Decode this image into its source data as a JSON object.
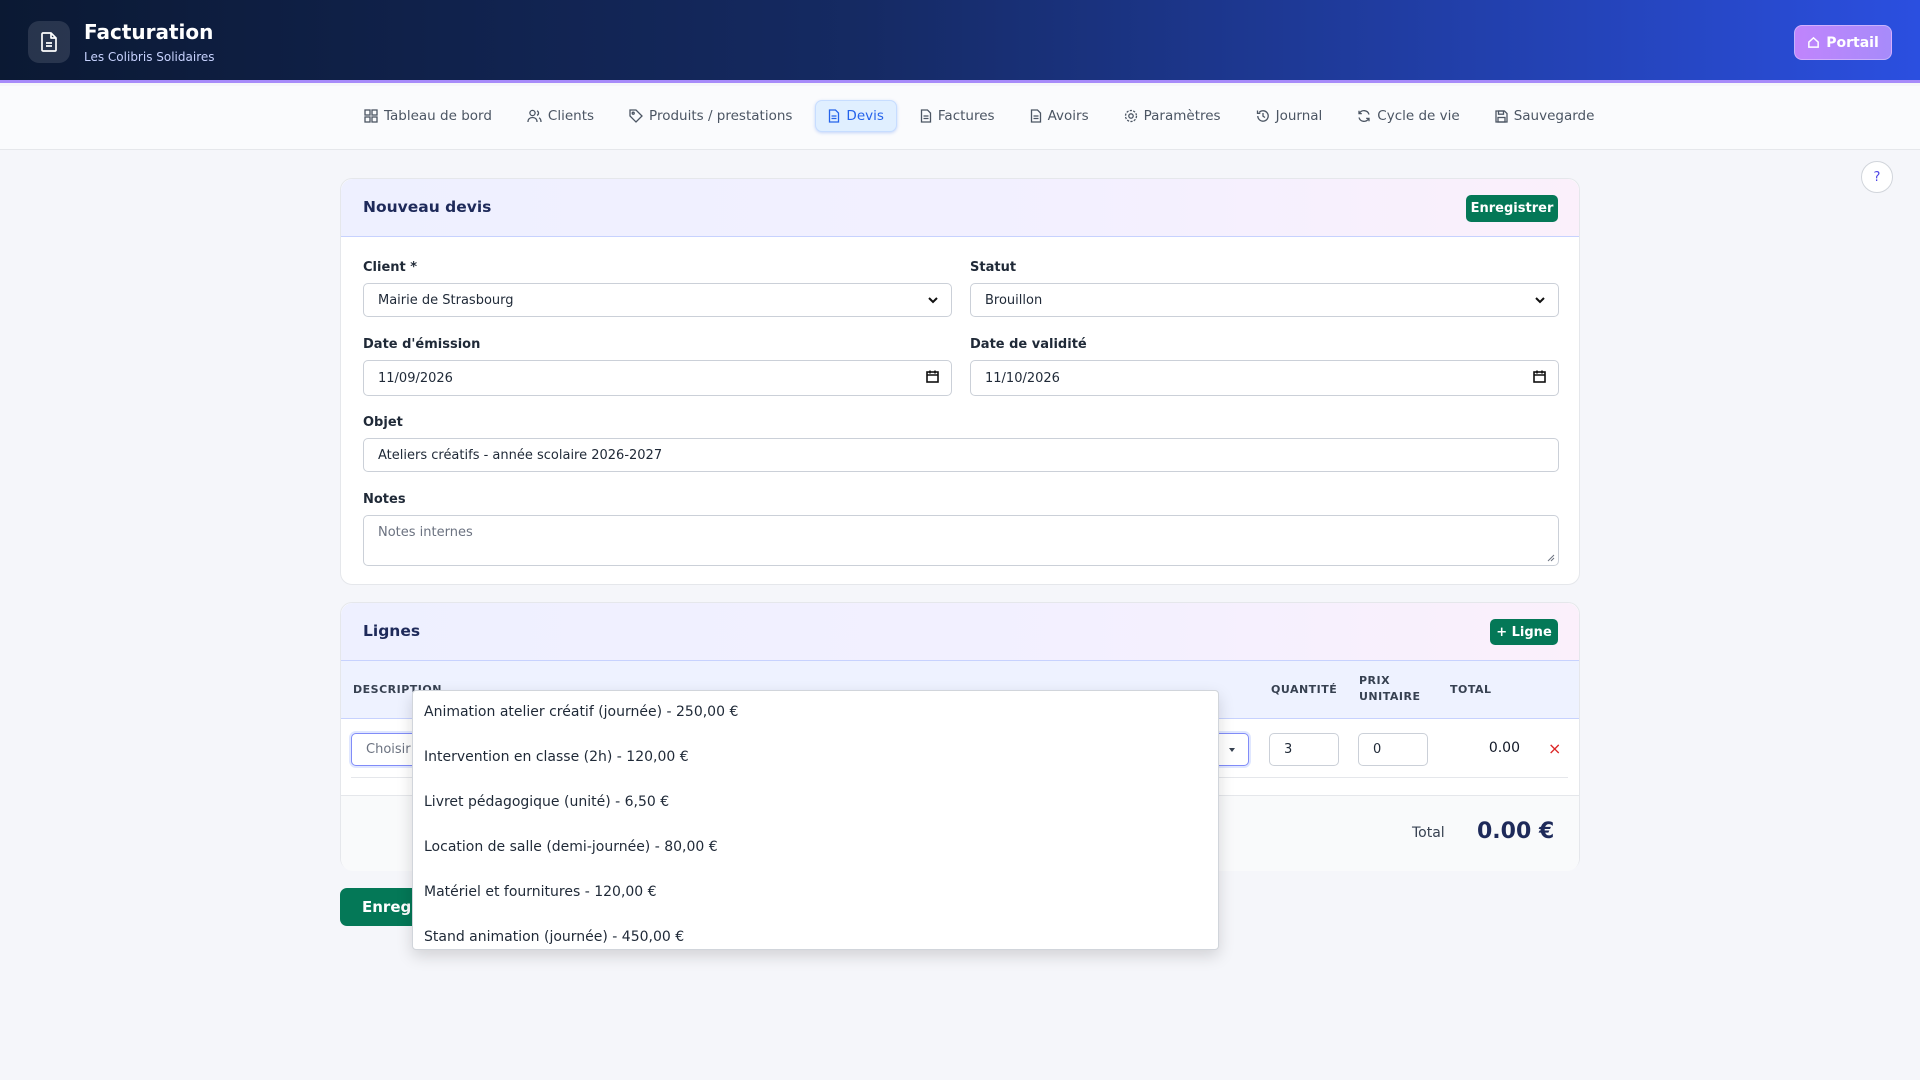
{
  "header": {
    "title": "Facturation",
    "subtitle": "Les Colibris Solidaires",
    "portal_label": "Portail"
  },
  "nav": {
    "items": [
      {
        "label": "Tableau de bord",
        "icon": "dashboard-icon"
      },
      {
        "label": "Clients",
        "icon": "users-icon"
      },
      {
        "label": "Produits / prestations",
        "icon": "tag-icon"
      },
      {
        "label": "Devis",
        "icon": "document-icon",
        "active": true
      },
      {
        "label": "Factures",
        "icon": "document-icon"
      },
      {
        "label": "Avoirs",
        "icon": "document-icon"
      },
      {
        "label": "Paramètres",
        "icon": "gear-icon"
      },
      {
        "label": "Journal",
        "icon": "history-icon"
      },
      {
        "label": "Cycle de vie",
        "icon": "refresh-icon"
      },
      {
        "label": "Sauvegarde",
        "icon": "save-icon"
      }
    ]
  },
  "help_label": "?",
  "quote_form": {
    "title": "Nouveau devis",
    "save_label": "Enregistrer",
    "client_label": "Client *",
    "client_value": "Mairie de Strasbourg",
    "status_label": "Statut",
    "status_value": "Brouillon",
    "issue_date_label": "Date d'émission",
    "issue_date_value": "11/09/2026",
    "validity_date_label": "Date de validité",
    "validity_date_value": "11/10/2026",
    "subject_label": "Objet",
    "subject_value": "Ateliers créatifs - année scolaire 2026-2027",
    "notes_label": "Notes",
    "notes_placeholder": "Notes internes"
  },
  "lines": {
    "title": "Lignes",
    "add_label": "+ Ligne",
    "columns": {
      "description": "DESCRIPTION",
      "quantity": "QUANTITÉ",
      "unit_price_1": "PRIX",
      "unit_price_2": "UNITAIRE",
      "total": "TOTAL"
    },
    "row": {
      "description_placeholder": "Choisir",
      "quantity": "3",
      "unit_price": "0",
      "total": "0.00",
      "remove": "×"
    },
    "total_label": "Total",
    "total_value": "0.00 €",
    "save_bottom_label": "Enregis"
  },
  "dropdown_options": [
    "Animation atelier créatif (journée) - 250,00 €",
    "Intervention en classe (2h) - 120,00 €",
    "Livret pédagogique (unité) - 6,50 €",
    "Location de salle (demi-journée) - 80,00 €",
    "Matériel et fournitures - 120,00 €",
    "Stand animation (journée) - 450,00 €"
  ]
}
